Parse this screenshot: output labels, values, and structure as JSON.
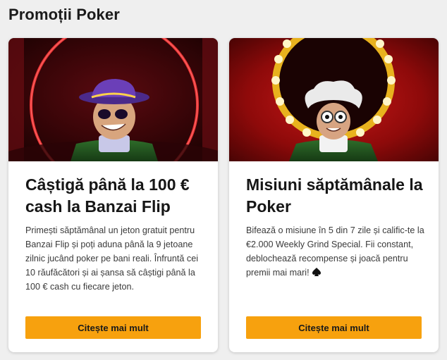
{
  "section": {
    "title": "Promoții Poker"
  },
  "cards": [
    {
      "image_alt": "Banzai Flip character",
      "title": "Câștigă până la 100 € cash la Banzai Flip",
      "description": "Primești săptămânal un jeton gratuit pentru Banzai Flip și poți aduna până la 9 jetoane zilnic jucând poker pe bani reali. Înfruntă cei 10 răufăcători și ai șansa să câștigi până la 100 € cash cu fiecare jeton.",
      "button_label": "Citește mai mult"
    },
    {
      "image_alt": "Weekly missions character",
      "title": "Misiuni săptămânale la Poker",
      "description": "Bifează o misiune în 5 din 7 zile și calific-te la €2.000 Weekly Grind Special. Fii constant, deblochează recompense și joacă pentru premii mai mari!",
      "description_icon": "spade-icon",
      "button_label": "Citește mai mult"
    }
  ],
  "colors": {
    "button": "#f7a10e",
    "background": "#efefef",
    "card": "#ffffff"
  }
}
